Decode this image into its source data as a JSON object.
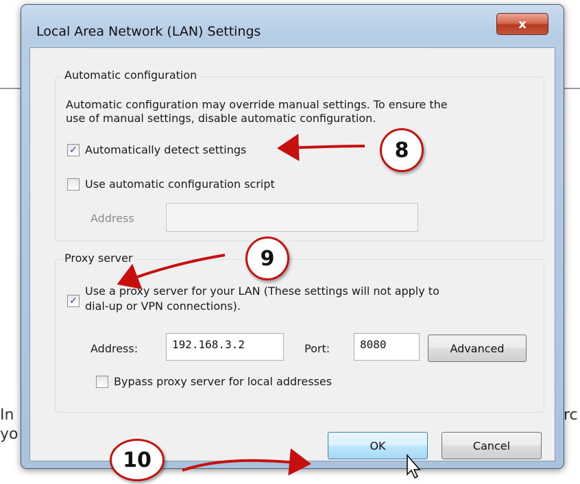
{
  "background": {
    "left_text": [
      "In",
      "yo"
    ],
    "right_text": "rc"
  },
  "dialog": {
    "title": "Local Area Network (LAN) Settings",
    "close_label": "x",
    "auto_config": {
      "group_label": "Automatic configuration",
      "description_line1": "Automatic configuration may override manual settings.  To ensure the",
      "description_line2": "use of manual settings, disable automatic configuration.",
      "detect_label": "Automatically detect settings",
      "detect_checked": true,
      "script_label": "Use automatic configuration script",
      "script_checked": false,
      "address_label": "Address",
      "address_value": ""
    },
    "proxy": {
      "group_label": "Proxy server",
      "use_proxy_line1": "Use a proxy server for your LAN (These settings will not apply to",
      "use_proxy_line2": "dial-up or VPN connections).",
      "use_proxy_checked": true,
      "address_label": "Address:",
      "address_value": "192.168.3.2",
      "port_label": "Port:",
      "port_value": "8080",
      "advanced_label": "Advanced",
      "bypass_label": "Bypass proxy server for local addresses",
      "bypass_checked": false
    },
    "ok_label": "OK",
    "cancel_label": "Cancel"
  },
  "annotations": {
    "step8": "8",
    "step9": "9",
    "step10": "10",
    "color": "#c6100e"
  },
  "icons": {
    "checkmark": "✓",
    "cursor": "mouse-pointer-icon"
  }
}
